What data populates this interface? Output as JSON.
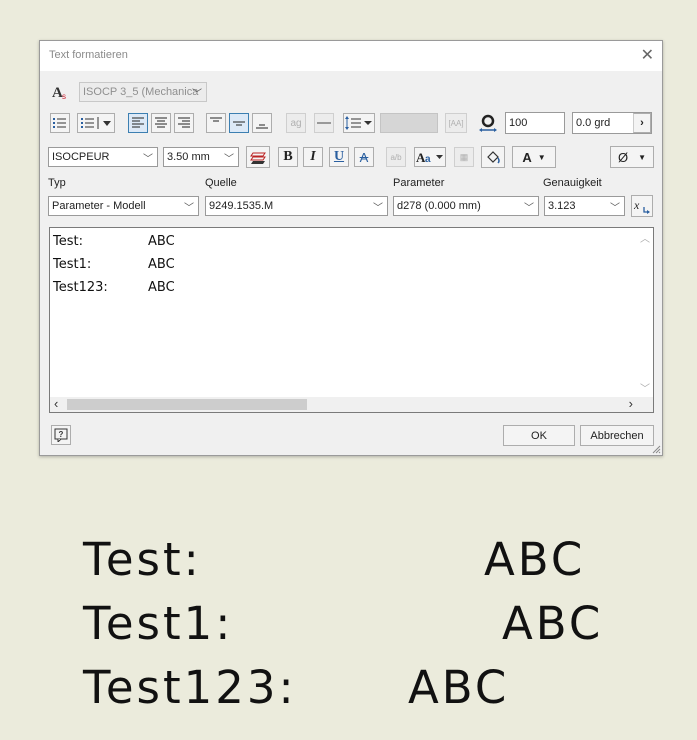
{
  "dialog": {
    "title": "Text formatieren",
    "close_glyph": "✕",
    "style_select": "ISOCP 3_5 (Mechanica",
    "rotation_value": "100",
    "angle_value": "0.0 grd",
    "font_select": "ISOCPEUR",
    "size_select": "3.50 mm",
    "bold": "B",
    "italic": "I",
    "underline": "U",
    "strike": "A",
    "color_btn": "A",
    "diameter_btn": "Ø",
    "labels": {
      "typ": "Typ",
      "quelle": "Quelle",
      "parameter": "Parameter",
      "genauigkeit": "Genauigkeit"
    },
    "typ_select": "Parameter - Modell",
    "quelle_select": "9249.1535.M",
    "parameter_select": "d278 (0.000 mm)",
    "genauigkeit_select": "3.123",
    "text_lines": [
      {
        "label": "Test:",
        "value": "ABC"
      },
      {
        "label": "Test1:",
        "value": "ABC"
      },
      {
        "label": "Test123:",
        "value": "ABC"
      }
    ],
    "ok_label": "OK",
    "cancel_label": "Abbrechen"
  },
  "preview": [
    {
      "label": "Test:",
      "value": "ABC"
    },
    {
      "label": "Test1:",
      "value": "ABC"
    },
    {
      "label": "Test123:",
      "value": "ABC"
    }
  ],
  "colors": {
    "background": "#ebebdc",
    "dialog": "#f0f0f0",
    "accent": "#3c7fb1"
  }
}
